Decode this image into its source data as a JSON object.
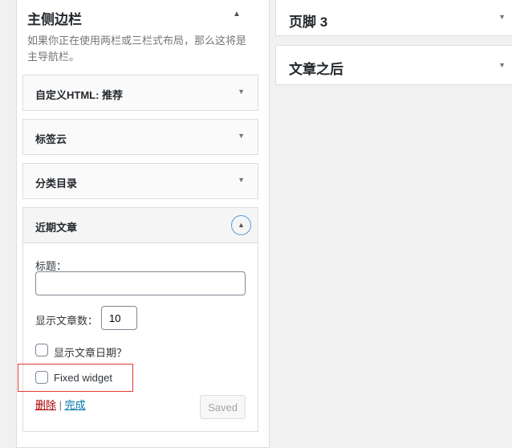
{
  "sidebar": {
    "title": "主侧边栏",
    "description": "如果你正在使用两栏或三栏式布局，那么这将是主导航栏。",
    "widgets": [
      {
        "title": "自定义HTML: 推荐"
      },
      {
        "title": "标签云"
      },
      {
        "title": "分类目录"
      },
      {
        "title": "近期文章"
      }
    ]
  },
  "recent_posts": {
    "title_label": "标题：",
    "title_value": "",
    "count_label": "显示文章数：",
    "count_value": "10",
    "show_date_label": "显示文章日期？",
    "fixed_widget_label": "Fixed widget",
    "delete_link": "删除",
    "separator": "|",
    "done_link": "完成",
    "saved_button": "Saved"
  },
  "right_areas": [
    {
      "title": "页脚 3"
    },
    {
      "title": "文章之后"
    }
  ],
  "icons": {
    "collapse": "▲",
    "expand": "▼"
  }
}
